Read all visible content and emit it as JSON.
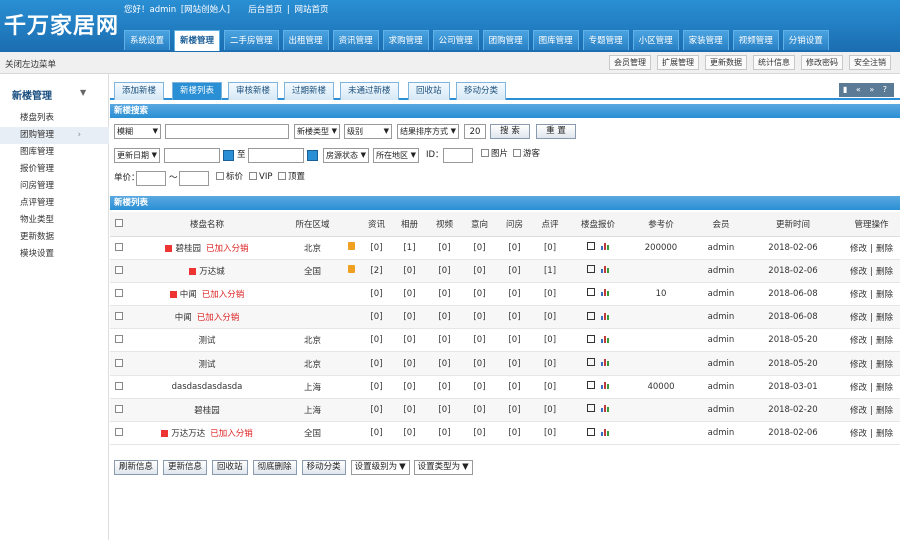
{
  "app": {
    "logo": "千万家居网",
    "greeting": "您好！admin",
    "greeting_role": "[网站创始人]",
    "link_admin_home": "后台首页",
    "link_site_home": "网站首页",
    "link_sep": "|"
  },
  "main_nav": [
    {
      "label": "系统设置",
      "active": false
    },
    {
      "label": "新楼管理",
      "active": true
    },
    {
      "label": "二手房管理",
      "active": false
    },
    {
      "label": "出租管理",
      "active": false
    },
    {
      "label": "资讯管理",
      "active": false
    },
    {
      "label": "求购管理",
      "active": false
    },
    {
      "label": "公司管理",
      "active": false
    },
    {
      "label": "团购管理",
      "active": false
    },
    {
      "label": "图库管理",
      "active": false
    },
    {
      "label": "专题管理",
      "active": false
    },
    {
      "label": "小区管理",
      "active": false
    },
    {
      "label": "家装管理",
      "active": false
    },
    {
      "label": "视频管理",
      "active": false
    },
    {
      "label": "分销设置",
      "active": false
    }
  ],
  "subbar": {
    "close_menu": "关闭左边菜单",
    "tools": [
      "会员管理",
      "扩展管理",
      "更新数据",
      "统计信息",
      "修改密码",
      "安全注销"
    ]
  },
  "sidebar": {
    "title": "新楼管理",
    "caret": "▼",
    "items": [
      "楼盘列表",
      "团购管理",
      "图库管理",
      "报价管理",
      "问房管理",
      "点评管理",
      "物业类型",
      "更新数据",
      "模块设置"
    ],
    "active_index": 1,
    "active_arrow": "›"
  },
  "tabs": [
    {
      "label": "添加新楼",
      "active": false
    },
    {
      "label": "新楼列表",
      "active": true
    },
    {
      "label": "审核新楼",
      "active": false
    },
    {
      "label": "过期新楼",
      "active": false
    },
    {
      "label": "未通过新楼",
      "active": false
    },
    {
      "label": "回收站",
      "active": false
    },
    {
      "label": "移动分类",
      "active": false
    }
  ],
  "pager_glyphs": "▮ « » ?",
  "search": {
    "section_title": "新楼搜索",
    "mode_select": "模糊",
    "keyword_value": "",
    "type_select": "新楼类型",
    "level_select": "级别",
    "sort_select": "结果排序方式",
    "page_size": "20",
    "search_button": "搜 索",
    "reset_button": "重 置",
    "date_select": "更新日期",
    "to_label": "至",
    "status_select": "房源状态",
    "area_select": "所在地区",
    "id_label": "ID：",
    "image_label": "图片",
    "tour_label": "游客",
    "price_label": "单价：",
    "tilde": "～",
    "tag_label": "标价",
    "vip_label": "VIP",
    "top_label": "顶置",
    "dropdown_glyph": "▼"
  },
  "list": {
    "section_title": "新楼列表",
    "columns": [
      "",
      "楼盘名称",
      "所在区域",
      "",
      "资讯",
      "相册",
      "视频",
      "意向",
      "问房",
      "点评",
      "楼盘报价",
      "参考价",
      "会员",
      "更新时间",
      "管理操作"
    ],
    "tag_distribution": "已加入分销",
    "ops_edit": "修改",
    "ops_sep": "|",
    "ops_delete": "删除",
    "rows": [
      {
        "name": "碧桂园",
        "icon": true,
        "dist": true,
        "area": "北京",
        "badge": true,
        "news": "[0]",
        "album": "[1]",
        "video": "[0]",
        "intent": "[0]",
        "ask": "[0]",
        "review": "[0]",
        "ref_price": "200000",
        "member": "admin",
        "updated": "2018-02-06"
      },
      {
        "name": "万达城",
        "icon": true,
        "dist": false,
        "area": "全国",
        "badge": true,
        "news": "[2]",
        "album": "[0]",
        "video": "[0]",
        "intent": "[0]",
        "ask": "[0]",
        "review": "[1]",
        "ref_price": "",
        "member": "admin",
        "updated": "2018-02-06"
      },
      {
        "name": "中闻",
        "icon": true,
        "dist": true,
        "area": "",
        "badge": false,
        "news": "[0]",
        "album": "[0]",
        "video": "[0]",
        "intent": "[0]",
        "ask": "[0]",
        "review": "[0]",
        "ref_price": "10",
        "member": "admin",
        "updated": "2018-06-08"
      },
      {
        "name": "中闻",
        "icon": false,
        "dist": true,
        "area": "",
        "badge": false,
        "news": "[0]",
        "album": "[0]",
        "video": "[0]",
        "intent": "[0]",
        "ask": "[0]",
        "review": "[0]",
        "ref_price": "",
        "member": "admin",
        "updated": "2018-06-08"
      },
      {
        "name": "测试",
        "icon": false,
        "dist": false,
        "area": "北京",
        "badge": false,
        "news": "[0]",
        "album": "[0]",
        "video": "[0]",
        "intent": "[0]",
        "ask": "[0]",
        "review": "[0]",
        "ref_price": "",
        "member": "admin",
        "updated": "2018-05-20"
      },
      {
        "name": "测试",
        "icon": false,
        "dist": false,
        "area": "北京",
        "badge": false,
        "news": "[0]",
        "album": "[0]",
        "video": "[0]",
        "intent": "[0]",
        "ask": "[0]",
        "review": "[0]",
        "ref_price": "",
        "member": "admin",
        "updated": "2018-05-20"
      },
      {
        "name": "dasdasdasdasda",
        "icon": false,
        "dist": false,
        "area": "上海",
        "badge": false,
        "news": "[0]",
        "album": "[0]",
        "video": "[0]",
        "intent": "[0]",
        "ask": "[0]",
        "review": "[0]",
        "ref_price": "40000",
        "member": "admin",
        "updated": "2018-03-01"
      },
      {
        "name": "碧桂园",
        "icon": false,
        "dist": false,
        "area": "上海",
        "badge": false,
        "news": "[0]",
        "album": "[0]",
        "video": "[0]",
        "intent": "[0]",
        "ask": "[0]",
        "review": "[0]",
        "ref_price": "",
        "member": "admin",
        "updated": "2018-02-20"
      },
      {
        "name": "万达万达",
        "icon": true,
        "dist": true,
        "area": "全国",
        "badge": false,
        "news": "[0]",
        "album": "[0]",
        "video": "[0]",
        "intent": "[0]",
        "ask": "[0]",
        "review": "[0]",
        "ref_price": "",
        "member": "admin",
        "updated": "2018-02-06"
      }
    ]
  },
  "bottom": {
    "buttons": [
      "刷新信息",
      "更新信息",
      "回收站",
      "彻底删除",
      "移动分类"
    ],
    "selects": [
      "设置级别为",
      "设置类型为"
    ]
  },
  "colors": {
    "accent": "#2a8fd4",
    "accent_dark": "#1b6db0",
    "danger": "#dd2222",
    "badge": "#f0a020"
  }
}
